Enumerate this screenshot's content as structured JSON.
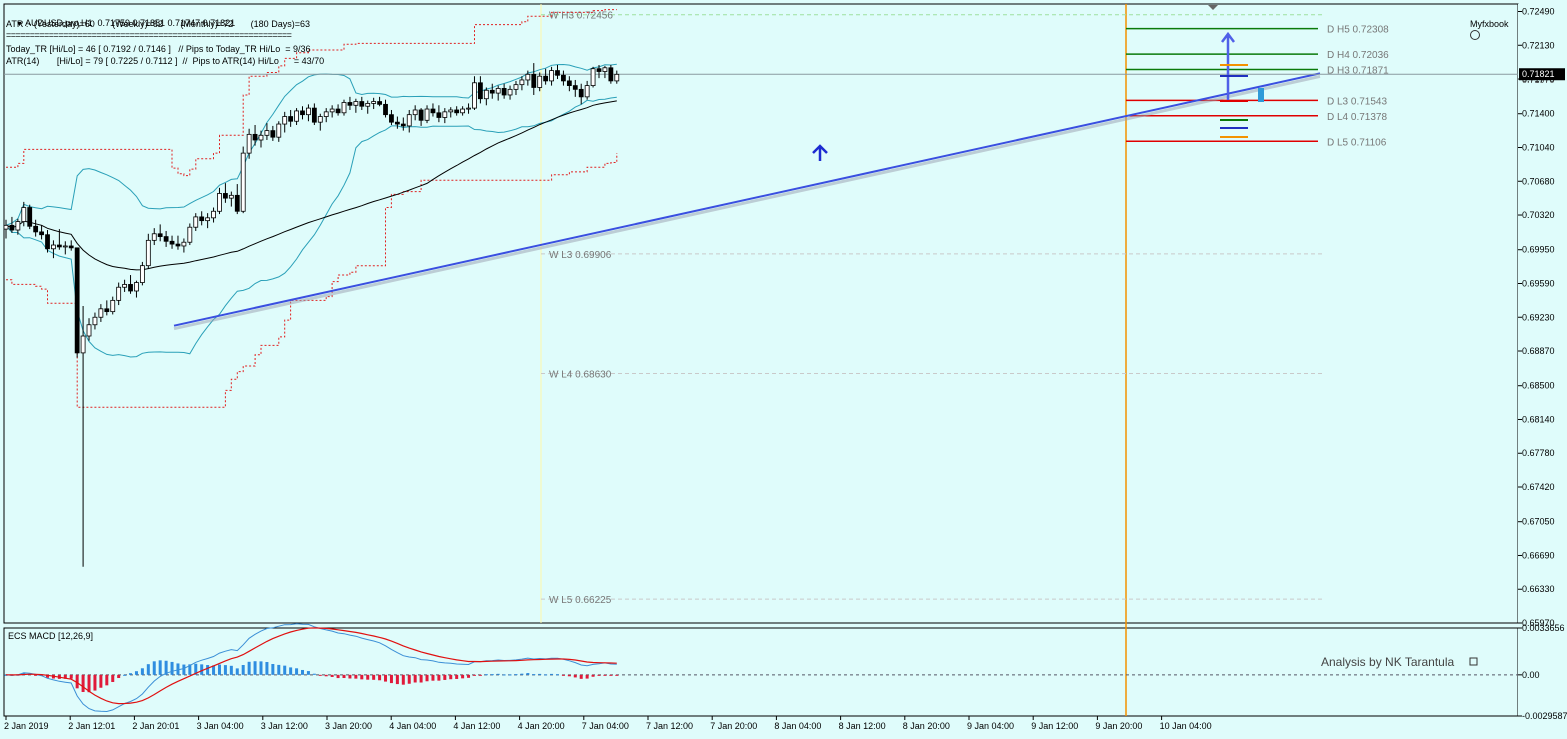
{
  "header": {
    "symbol_line": "AUDUSD,pro,H1  0.71759 0.71851 0.71747 0.71821",
    "atr_line": "ATR :- (Yesterday)=60       (Weekly)=62       (Monthly)=72       (180 Days)=63",
    "separator": "============================================================",
    "today_tr_line": "Today_TR [Hi/Lo] = 46 [ 0.7192 / 0.7146 ]   // Pips to Today_TR Hi/Lo  = 9/36",
    "atr14_line": "ATR(14)       [Hi/Lo] = 79 [ 0.7225 / 0.7112 ]  //  Pips to ATR(14) Hi/Lo      = 43/70",
    "brand": "Myfxbook",
    "brand_icon": "myfxbook-logo-icon"
  },
  "colors": {
    "background": "#dffcfb",
    "bull_candle": "#ffffff",
    "bear_candle": "#000000",
    "bollinger": "#2aa0b8",
    "envelope": "#e02020",
    "ma_slow": "#000000",
    "trendline": "#3a4fe0",
    "session_line": "#f39200",
    "macd_line": "#3b8fd6",
    "signal_line": "#e01010",
    "hist_pos": "#2e8de0",
    "hist_neg": "#e01a3a"
  },
  "chart_data": [
    {
      "type": "candlestick",
      "title": "AUDUSD,pro,H1",
      "timeframe": "H1",
      "ylim": [
        0.6597,
        0.7257
      ],
      "x_ticks": [
        "2 Jan 2019",
        "2 Jan 12:01",
        "2 Jan 20:01",
        "3 Jan 04:00",
        "3 Jan 12:00",
        "3 Jan 20:00",
        "4 Jan 04:00",
        "4 Jan 12:00",
        "4 Jan 20:00",
        "7 Jan 04:00",
        "7 Jan 12:00",
        "7 Jan 20:00",
        "8 Jan 04:00",
        "8 Jan 12:00",
        "8 Jan 20:00",
        "9 Jan 04:00",
        "9 Jan 12:00",
        "9 Jan 20:00",
        "10 Jan 04:00"
      ],
      "y_ticks": [
        0.7249,
        0.7213,
        0.7177,
        0.714,
        0.7104,
        0.7068,
        0.7032,
        0.6995,
        0.6959,
        0.6923,
        0.6887,
        0.685,
        0.6814,
        0.6778,
        0.6742,
        0.6705,
        0.6669,
        0.6633,
        0.6597
      ],
      "current_price": 0.71821,
      "current_price_label": "0.71821",
      "current_price_shadow_label": "0.71970",
      "levels": [
        {
          "label": "W  H3 0.72456",
          "value": 0.72456,
          "style": "weekly",
          "color": "#9ee09e"
        },
        {
          "label": "W  L3 0.69906",
          "value": 0.69906,
          "style": "weekly",
          "color": "#c9c9c9"
        },
        {
          "label": "W  L4 0.68630",
          "value": 0.6863,
          "style": "weekly",
          "color": "#c9c9c9"
        },
        {
          "label": "W  L5 0.66225",
          "value": 0.66225,
          "style": "weekly",
          "color": "#c9c9c9"
        },
        {
          "label": "D  H5 0.72308",
          "value": 0.72308,
          "style": "daily",
          "color": "#0a7a0a"
        },
        {
          "label": "D  H4 0.72036",
          "value": 0.72036,
          "style": "daily",
          "color": "#0a7a0a"
        },
        {
          "label": "D  H3 0.71871",
          "value": 0.71871,
          "style": "daily",
          "color": "#0a7a0a"
        },
        {
          "label": "D  L3 0.71543",
          "value": 0.71543,
          "style": "daily",
          "color": "#e00000"
        },
        {
          "label": "D  L4 0.71378",
          "value": 0.71378,
          "style": "daily",
          "color": "#e00000"
        },
        {
          "label": "D  L5 0.71106",
          "value": 0.71106,
          "style": "daily",
          "color": "#e00000"
        }
      ],
      "candles": [
        [
          0.7017,
          0.7027,
          0.7007,
          0.7021
        ],
        [
          0.7021,
          0.703,
          0.7013,
          0.7016
        ],
        [
          0.7016,
          0.7028,
          0.7011,
          0.7025
        ],
        [
          0.7025,
          0.7046,
          0.702,
          0.704
        ],
        [
          0.704,
          0.7043,
          0.7017,
          0.702
        ],
        [
          0.702,
          0.7027,
          0.7009,
          0.7014
        ],
        [
          0.7014,
          0.7021,
          0.7006,
          0.7011
        ],
        [
          0.7011,
          0.7016,
          0.6992,
          0.6996
        ],
        [
          0.6996,
          0.7005,
          0.6986,
          0.7
        ],
        [
          0.7,
          0.7017,
          0.6995,
          0.6998
        ],
        [
          0.6998,
          0.7004,
          0.699,
          0.6999
        ],
        [
          0.6999,
          0.7005,
          0.6994,
          0.6997
        ],
        [
          0.6997,
          0.698,
          0.688,
          0.6885
        ],
        [
          0.6885,
          0.6935,
          0.6657,
          0.6903
        ],
        [
          0.6903,
          0.6922,
          0.6898,
          0.6915
        ],
        [
          0.6915,
          0.6928,
          0.691,
          0.6923
        ],
        [
          0.6923,
          0.6937,
          0.6918,
          0.6932
        ],
        [
          0.6932,
          0.6941,
          0.6925,
          0.6929
        ],
        [
          0.6929,
          0.6945,
          0.6926,
          0.6941
        ],
        [
          0.6941,
          0.696,
          0.6936,
          0.6955
        ],
        [
          0.6955,
          0.6963,
          0.695,
          0.6958
        ],
        [
          0.6958,
          0.6968,
          0.6948,
          0.6951
        ],
        [
          0.6951,
          0.6962,
          0.6944,
          0.696
        ],
        [
          0.696,
          0.6982,
          0.6957,
          0.6978
        ],
        [
          0.6978,
          0.7012,
          0.6975,
          0.7005
        ],
        [
          0.7005,
          0.7018,
          0.7,
          0.7012
        ],
        [
          0.7012,
          0.7022,
          0.7004,
          0.7009
        ],
        [
          0.7009,
          0.7015,
          0.6998,
          0.7004
        ],
        [
          0.7004,
          0.701,
          0.6996,
          0.7001
        ],
        [
          0.7001,
          0.701,
          0.6995,
          0.6999
        ],
        [
          0.6999,
          0.7007,
          0.6992,
          0.7003
        ],
        [
          0.7003,
          0.7023,
          0.7,
          0.7019
        ],
        [
          0.7019,
          0.7034,
          0.7015,
          0.703
        ],
        [
          0.703,
          0.7036,
          0.7021,
          0.7026
        ],
        [
          0.7026,
          0.7034,
          0.7018,
          0.7029
        ],
        [
          0.7029,
          0.704,
          0.7024,
          0.7036
        ],
        [
          0.7036,
          0.7061,
          0.7033,
          0.7055
        ],
        [
          0.7055,
          0.7066,
          0.7045,
          0.705
        ],
        [
          0.705,
          0.7057,
          0.7041,
          0.7053
        ],
        [
          0.7053,
          0.7065,
          0.7033,
          0.7036
        ],
        [
          0.7036,
          0.7105,
          0.7034,
          0.7098
        ],
        [
          0.7098,
          0.7124,
          0.7092,
          0.7118
        ],
        [
          0.7118,
          0.7128,
          0.7106,
          0.7112
        ],
        [
          0.7112,
          0.7122,
          0.7104,
          0.7117
        ],
        [
          0.7117,
          0.713,
          0.7112,
          0.7122
        ],
        [
          0.7122,
          0.7127,
          0.7111,
          0.7115
        ],
        [
          0.7115,
          0.7132,
          0.711,
          0.7129
        ],
        [
          0.7129,
          0.7142,
          0.712,
          0.7137
        ],
        [
          0.7137,
          0.7144,
          0.7126,
          0.7132
        ],
        [
          0.7132,
          0.7146,
          0.7128,
          0.7143
        ],
        [
          0.7143,
          0.7148,
          0.7134,
          0.7139
        ],
        [
          0.7139,
          0.715,
          0.7132,
          0.7146
        ],
        [
          0.7146,
          0.7151,
          0.7128,
          0.7131
        ],
        [
          0.7131,
          0.714,
          0.7122,
          0.7137
        ],
        [
          0.7137,
          0.7146,
          0.7131,
          0.7142
        ],
        [
          0.7142,
          0.7149,
          0.7136,
          0.7145
        ],
        [
          0.7145,
          0.715,
          0.7138,
          0.7141
        ],
        [
          0.7141,
          0.7155,
          0.7138,
          0.7152
        ],
        [
          0.7152,
          0.7158,
          0.7144,
          0.7149
        ],
        [
          0.7149,
          0.7156,
          0.7141,
          0.7153
        ],
        [
          0.7153,
          0.7158,
          0.7144,
          0.7148
        ],
        [
          0.7148,
          0.7154,
          0.714,
          0.7151
        ],
        [
          0.7151,
          0.7157,
          0.7145,
          0.7153
        ],
        [
          0.7153,
          0.7158,
          0.7148,
          0.715
        ],
        [
          0.715,
          0.7155,
          0.7136,
          0.7139
        ],
        [
          0.7139,
          0.7144,
          0.7128,
          0.7131
        ],
        [
          0.7131,
          0.7137,
          0.7124,
          0.7129
        ],
        [
          0.7129,
          0.7136,
          0.7122,
          0.7127
        ],
        [
          0.7127,
          0.7144,
          0.712,
          0.7139
        ],
        [
          0.7139,
          0.7149,
          0.7133,
          0.7144
        ],
        [
          0.7144,
          0.7146,
          0.7127,
          0.7133
        ],
        [
          0.7133,
          0.7149,
          0.713,
          0.7145
        ],
        [
          0.7145,
          0.7151,
          0.7137,
          0.7141
        ],
        [
          0.7141,
          0.7149,
          0.7131,
          0.7136
        ],
        [
          0.7136,
          0.7146,
          0.713,
          0.7142
        ],
        [
          0.7142,
          0.7147,
          0.7136,
          0.7144
        ],
        [
          0.7144,
          0.7148,
          0.7138,
          0.7141
        ],
        [
          0.7141,
          0.7148,
          0.7138,
          0.7145
        ],
        [
          0.7145,
          0.7151,
          0.714,
          0.7146
        ],
        [
          0.7146,
          0.718,
          0.7144,
          0.7173
        ],
        [
          0.7173,
          0.718,
          0.7151,
          0.7156
        ],
        [
          0.7156,
          0.7168,
          0.7149,
          0.7165
        ],
        [
          0.7165,
          0.7172,
          0.7156,
          0.7162
        ],
        [
          0.7162,
          0.717,
          0.7154,
          0.7167
        ],
        [
          0.7167,
          0.7172,
          0.7156,
          0.716
        ],
        [
          0.716,
          0.717,
          0.7155,
          0.7166
        ],
        [
          0.7166,
          0.7175,
          0.716,
          0.7171
        ],
        [
          0.7171,
          0.718,
          0.7165,
          0.7176
        ],
        [
          0.7176,
          0.7186,
          0.717,
          0.7182
        ],
        [
          0.7182,
          0.7194,
          0.716,
          0.7168
        ],
        [
          0.7168,
          0.7184,
          0.7164,
          0.718
        ],
        [
          0.718,
          0.7188,
          0.7171,
          0.7175
        ],
        [
          0.7175,
          0.719,
          0.717,
          0.7186
        ],
        [
          0.7186,
          0.7192,
          0.7177,
          0.7181
        ],
        [
          0.7181,
          0.7186,
          0.717,
          0.7175
        ],
        [
          0.7175,
          0.718,
          0.7164,
          0.717
        ],
        [
          0.717,
          0.7176,
          0.7158,
          0.7166
        ],
        [
          0.7166,
          0.7172,
          0.715,
          0.7158
        ],
        [
          0.7158,
          0.7175,
          0.7155,
          0.717
        ],
        [
          0.717,
          0.719,
          0.7168,
          0.7188
        ],
        [
          0.7188,
          0.7192,
          0.7178,
          0.7185
        ],
        [
          0.7185,
          0.7191,
          0.7178,
          0.7189
        ],
        [
          0.7189,
          0.7192,
          0.7172,
          0.7175
        ],
        [
          0.7175,
          0.7186,
          0.7172,
          0.7182
        ]
      ]
    },
    {
      "type": "bar",
      "title": "ECS MACD [12,26,9]",
      "ylim": [
        -0.002958,
        0.003366
      ],
      "y_ticks": [
        0.0033656,
        0.0,
        -0.0029587
      ],
      "y_tick_labels": [
        "0.0033656",
        "0.00",
        "-0.0029587"
      ],
      "annotation": "Analysis by NK Tarantula"
    }
  ]
}
